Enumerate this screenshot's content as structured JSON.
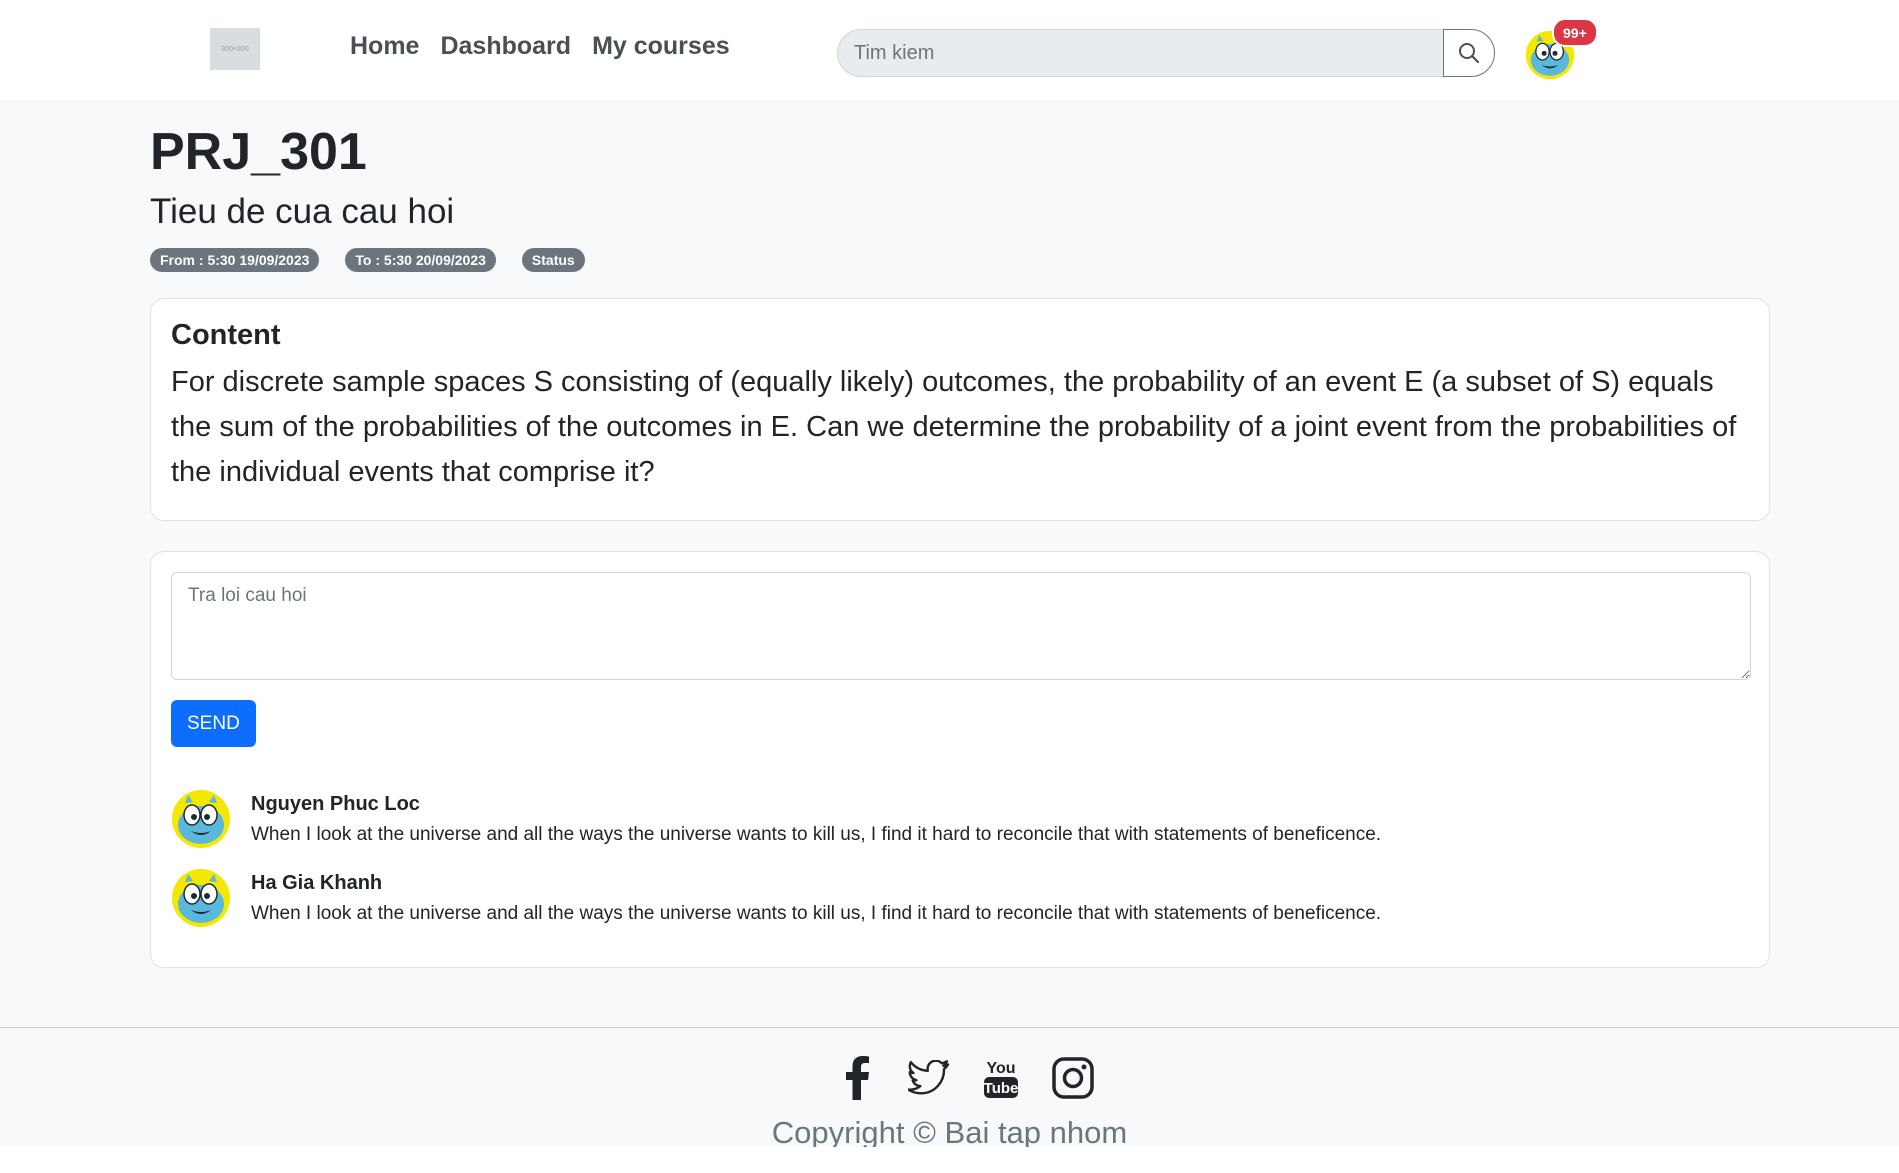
{
  "navbar": {
    "logo_text": "300×300",
    "links": [
      "Home",
      "Dashboard",
      "My courses"
    ],
    "search_placeholder": "Tim kiem",
    "notification_count": "99+"
  },
  "page": {
    "course_code": "PRJ_301",
    "question_title": "Tieu de cua cau hoi",
    "badges": {
      "from": "From : 5:30 19/09/2023",
      "to": "To : 5:30 20/09/2023",
      "status": "Status"
    }
  },
  "content": {
    "heading": "Content",
    "text": "For discrete sample spaces S consisting of (equally likely) outcomes, the probability of an event E (a subset of S) equals the sum of the probabilities of the outcomes in E. Can we determine the probability of a joint event from the probabilities of the individual events that comprise it?"
  },
  "answer": {
    "placeholder": "Tra loi cau hoi",
    "send_label": "SEND"
  },
  "comments": [
    {
      "author": "Nguyen Phuc Loc",
      "text": "When I look at the universe and all the ways the universe wants to kill us, I find it hard to reconcile that with statements of beneficence."
    },
    {
      "author": "Ha Gia Khanh",
      "text": "When I look at the universe and all the ways the universe wants to kill us, I find it hard to reconcile that with statements of beneficence."
    }
  ],
  "footer": {
    "social_icons": [
      "facebook-icon",
      "twitter-icon",
      "youtube-icon",
      "instagram-icon"
    ],
    "youtube_text": [
      "You",
      "Tube"
    ],
    "copyright": "Copyright © Bai tap nhom"
  },
  "colors": {
    "primary": "#0d6efd",
    "badge": "#6c757d",
    "notification": "#dc3545",
    "avatar_bg": "#f5e800",
    "avatar_face": "#5bb8dd"
  }
}
